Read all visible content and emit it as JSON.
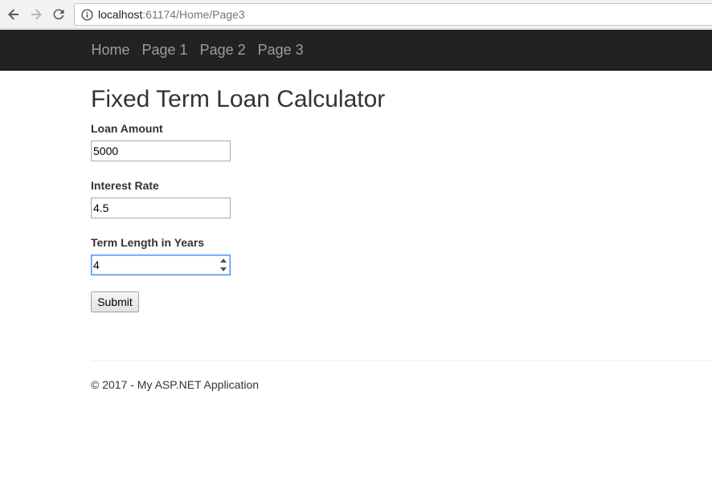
{
  "browser": {
    "url_host": "localhost",
    "url_path": ":61174/Home/Page3",
    "icons": {
      "back": "back-arrow-icon",
      "forward": "forward-arrow-icon",
      "reload": "reload-icon",
      "info": "info-icon"
    }
  },
  "navbar": {
    "links": [
      {
        "label": "Home"
      },
      {
        "label": "Page 1"
      },
      {
        "label": "Page 2"
      },
      {
        "label": "Page 3"
      }
    ],
    "background": "#222222",
    "link_color": "#9d9d9d"
  },
  "main": {
    "title": "Fixed Term Loan Calculator",
    "fields": [
      {
        "label": "Loan Amount",
        "value": "5000"
      },
      {
        "label": "Interest Rate",
        "value": "4.5"
      },
      {
        "label": "Term Length in Years",
        "value": "4"
      }
    ],
    "submit_label": "Submit"
  },
  "footer": {
    "text": "© 2017 - My ASP.NET Application"
  }
}
